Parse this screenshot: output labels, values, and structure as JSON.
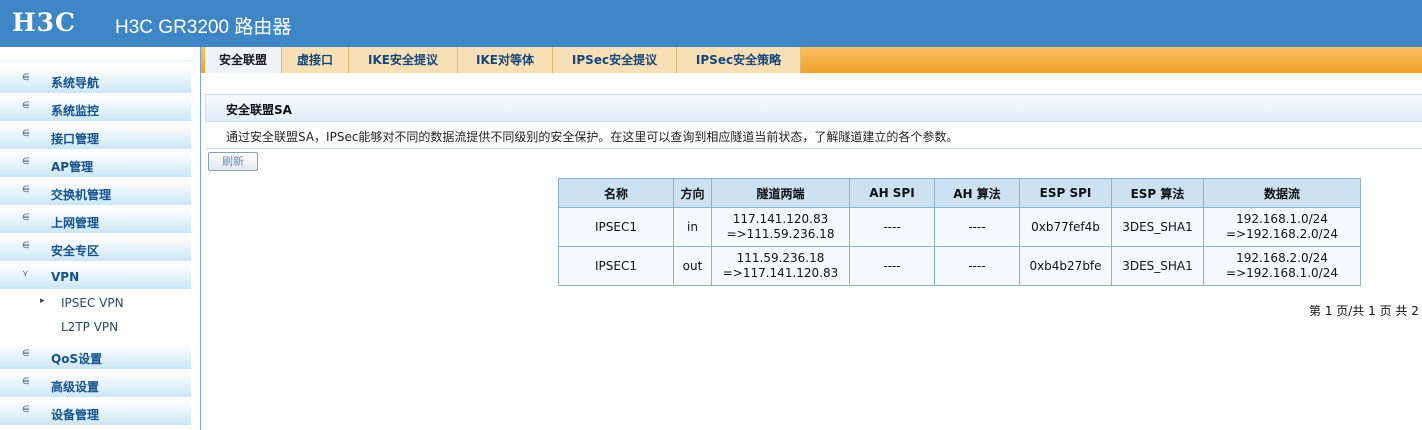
{
  "header": {
    "logo": "H3C",
    "title": "H3C GR3200 路由器"
  },
  "sidebar": {
    "items": [
      {
        "label": "系统导航"
      },
      {
        "label": "系统监控"
      },
      {
        "label": "接口管理"
      },
      {
        "label": "AP管理"
      },
      {
        "label": "交换机管理"
      },
      {
        "label": "上网管理"
      },
      {
        "label": "安全专区"
      },
      {
        "label": "VPN",
        "expanded": true
      },
      {
        "label": "QoS设置"
      },
      {
        "label": "高级设置"
      },
      {
        "label": "设备管理"
      }
    ],
    "vpn_subitems": [
      {
        "label": "IPSEC VPN",
        "selected": true
      },
      {
        "label": "L2TP VPN"
      }
    ]
  },
  "tabs": [
    {
      "label": "安全联盟",
      "active": true
    },
    {
      "label": "虚接口"
    },
    {
      "label": "IKE安全提议"
    },
    {
      "label": "IKE对等体"
    },
    {
      "label": "IPSec安全提议"
    },
    {
      "label": "IPSec安全策略"
    }
  ],
  "section": {
    "title": "安全联盟SA",
    "description": "通过安全联盟SA，IPSec能够对不同的数据流提供不同级别的安全保护。在这里可以查询到相应隧道当前状态，了解隧道建立的各个参数。",
    "refresh_label": "刷新"
  },
  "table": {
    "headers": [
      "名称",
      "方向",
      "隧道两端",
      "AH SPI",
      "AH 算法",
      "ESP SPI",
      "ESP 算法",
      "数据流"
    ],
    "rows": [
      {
        "name": "IPSEC1",
        "direction": "in",
        "tunnel_1": "117.141.120.83",
        "tunnel_2": "=>111.59.236.18",
        "ah_spi": "----",
        "ah_alg": "----",
        "esp_spi": "0xb77fef4b",
        "esp_alg": "3DES_SHA1",
        "flow_1": "192.168.1.0/24",
        "flow_2": "=>192.168.2.0/24"
      },
      {
        "name": "IPSEC1",
        "direction": "out",
        "tunnel_1": "111.59.236.18",
        "tunnel_2": "=>117.141.120.83",
        "ah_spi": "----",
        "ah_alg": "----",
        "esp_spi": "0xb4b27bfe",
        "esp_alg": "3DES_SHA1",
        "flow_1": "192.168.2.0/24",
        "flow_2": "=>192.168.1.0/24"
      }
    ]
  },
  "pager": {
    "text": "第 1 页/共 1 页 共 2"
  },
  "colors": {
    "header": "#3f86c6",
    "tabbar": "#f0a22b",
    "table_header": "#cce1f2",
    "menu_text": "#15538f"
  }
}
